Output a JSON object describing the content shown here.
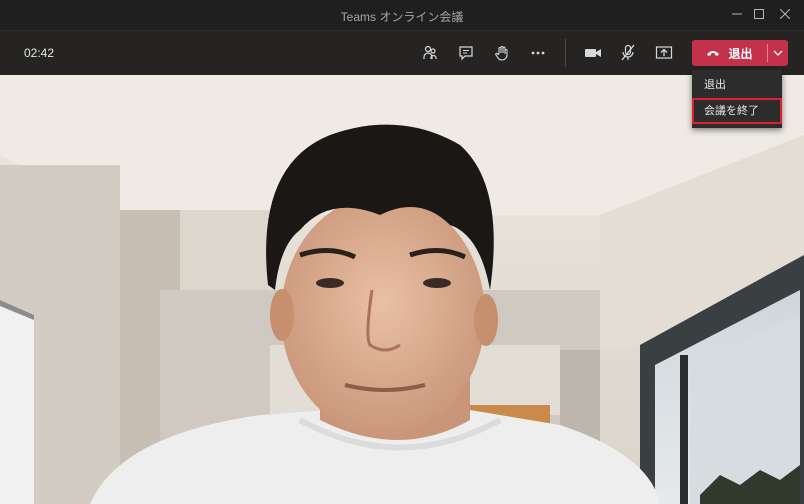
{
  "window": {
    "title": "Teams オンライン会議"
  },
  "toolbar": {
    "timer": "02:42",
    "leave_label": "退出"
  },
  "leave_menu": {
    "items": [
      {
        "label": "退出"
      },
      {
        "label": "会議を終了"
      }
    ]
  },
  "colors": {
    "leave_red": "#c4314b",
    "highlight_outline": "#e0202e",
    "toolbar_bg": "#252423"
  },
  "icons": [
    "participants-icon",
    "chat-icon",
    "raise-hand-icon",
    "more-options-icon",
    "camera-icon",
    "mic-muted-icon",
    "share-screen-icon",
    "phone-hangup-icon",
    "chevron-down-icon"
  ]
}
